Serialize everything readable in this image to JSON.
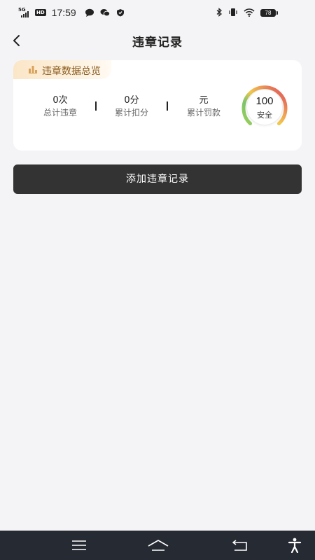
{
  "status_bar": {
    "network": "5G",
    "hd": "HD",
    "time": "17:59",
    "battery": "78",
    "icons": [
      "chat-bubble-icon",
      "wechat-icon",
      "shield-icon",
      "bluetooth-icon",
      "vibrate-icon",
      "wifi-icon",
      "battery-icon"
    ]
  },
  "nav": {
    "title": "违章记录",
    "back_icon": "chevron-left-icon"
  },
  "summary": {
    "tag": "违章数据总览",
    "tag_icon": "bar-chart-icon",
    "stats": [
      {
        "value": "0次",
        "label": "总计违章"
      },
      {
        "value": "0分",
        "label": "累计扣分"
      },
      {
        "value": "元",
        "label": "累计罚款"
      }
    ],
    "gauge": {
      "score": "100",
      "label": "安全",
      "level": 1.0,
      "colors": [
        "#f2c94c",
        "#7cc46a",
        "#e35a5a"
      ]
    }
  },
  "actions": {
    "add_label": "添加违章记录"
  },
  "system_nav": {
    "icons": [
      "menu-icon",
      "home-icon",
      "back-icon",
      "accessibility-icon"
    ]
  },
  "colors": {
    "tag_text": "#8a5a1c",
    "button_bg": "#333333",
    "background": "#f4f4f6"
  }
}
